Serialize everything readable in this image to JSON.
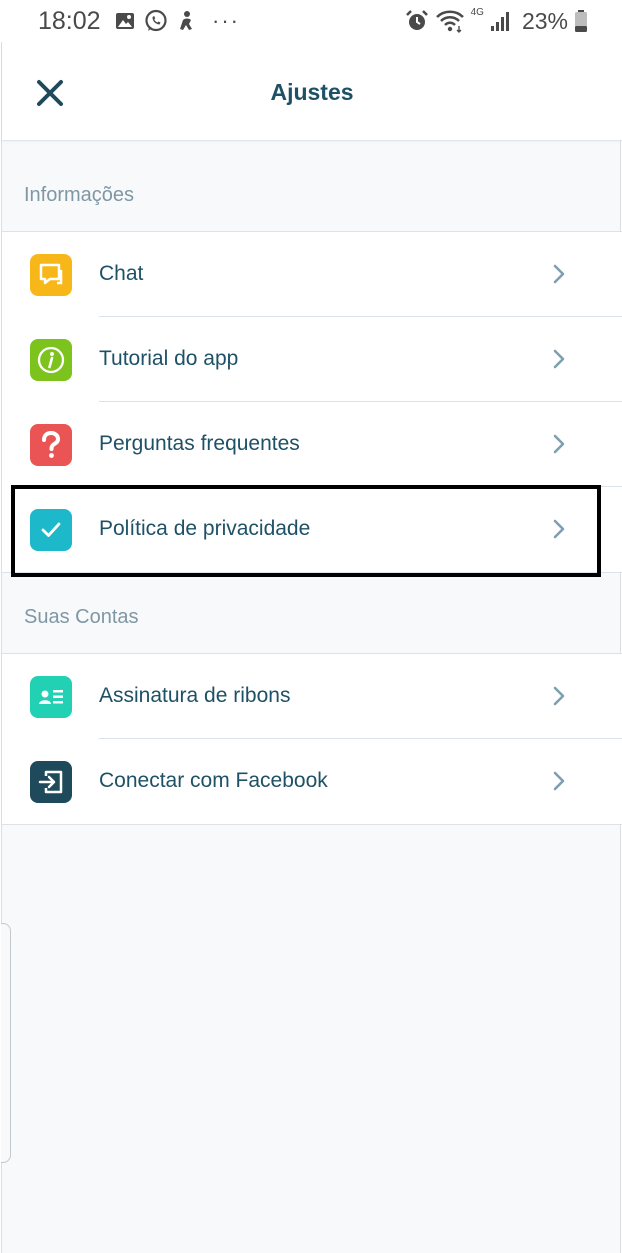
{
  "status_bar": {
    "time": "18:02",
    "network": "4G",
    "battery": "23%",
    "more": "···"
  },
  "header": {
    "title": "Ajustes",
    "close_icon": "close-icon"
  },
  "sections": [
    {
      "label": "Informações",
      "items": [
        {
          "label": "Chat",
          "icon": "chat-icon",
          "color": "#f7b718"
        },
        {
          "label": "Tutorial do app",
          "icon": "info-icon",
          "color": "#7cc31e"
        },
        {
          "label": "Perguntas frequentes",
          "icon": "question-icon",
          "color": "#ea5454"
        },
        {
          "label": "Política de privacidade",
          "icon": "check-icon",
          "color": "#1db8c9"
        }
      ]
    },
    {
      "label": "Suas Contas",
      "items": [
        {
          "label": "Assinatura de ribons",
          "icon": "id-card-icon",
          "color": "#22d0b3"
        },
        {
          "label": "Conectar com Facebook",
          "icon": "login-icon",
          "color": "#1f4a5c"
        }
      ]
    }
  ],
  "colors": {
    "accent_text": "#1f5166",
    "section_label": "#7f97a4",
    "chevron": "#7e9fb0"
  }
}
